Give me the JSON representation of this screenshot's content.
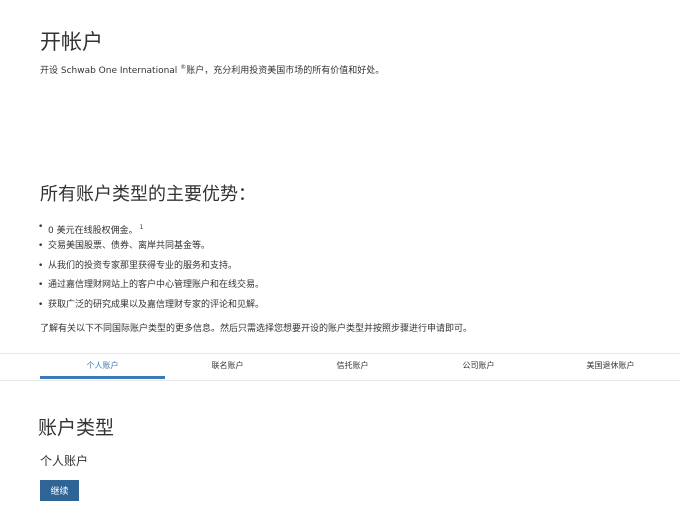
{
  "header": {
    "title": "开帐户",
    "intro_before": "开设 Schwab One International",
    "intro_sup": "®",
    "intro_after": "账户，充分利用投资美国市场的所有价值和好处。"
  },
  "benefits": {
    "title": "所有账户类型的主要优势：",
    "items": [
      {
        "text": "0 美元在线股权佣金。",
        "footnote": "1"
      },
      {
        "text": "交易美国股票、债券、离岸共同基金等。"
      },
      {
        "text": "从我们的投资专家那里获得专业的服务和支持。"
      },
      {
        "text": "通过嘉信理财网站上的客户中心管理账户和在线交易。"
      },
      {
        "text": "获取广泛的研究成果以及嘉信理财专家的评论和见解。"
      }
    ],
    "bullet": "•"
  },
  "more_info": "了解有关以下不同国际账户类型的更多信息。然后只需选择您想要开设的账户类型并按照步骤进行申请即可。",
  "tabs": [
    {
      "label": "个人账户",
      "active": true
    },
    {
      "label": "联名账户"
    },
    {
      "label": "信托账户"
    },
    {
      "label": "公司账户"
    },
    {
      "label": "美国退休账户"
    }
  ],
  "account_type": {
    "title": "账户类型",
    "selected": "个人账户",
    "continue_label": "继续"
  },
  "colors": {
    "accent": "#3a7ab8",
    "button": "#2e6596",
    "text": "#333333"
  }
}
